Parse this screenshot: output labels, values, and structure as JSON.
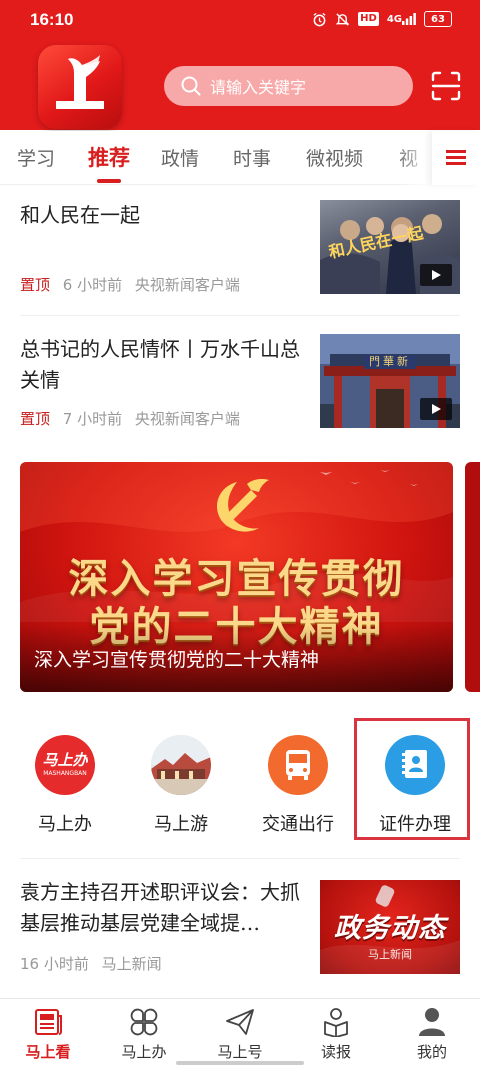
{
  "status_bar": {
    "time": "16:10",
    "hd": "HD",
    "signal": "4G",
    "battery": "63"
  },
  "header": {
    "app_name": "马上看",
    "search_placeholder": "请输入关键字"
  },
  "tabs": [
    {
      "label": "学习",
      "active": false
    },
    {
      "label": "推荐",
      "active": true
    },
    {
      "label": "政情",
      "active": false
    },
    {
      "label": "时事",
      "active": false
    },
    {
      "label": "微视频",
      "active": false
    },
    {
      "label": "视",
      "active": false
    }
  ],
  "news": [
    {
      "title": "和人民在一起",
      "pinned": "置顶",
      "time": "6 小时前",
      "source": "央视新闻客户端",
      "thumb_text": "和人民在一起",
      "has_video": true
    },
    {
      "title": "总书记的人民情怀丨万水千山总关情",
      "pinned": "置顶",
      "time": "7 小时前",
      "source": "央视新闻客户端",
      "thumb_text": "門華新",
      "has_video": true
    }
  ],
  "banner": {
    "line1": "深入学习宣传贯彻",
    "line2": "党的二十大精神",
    "caption": "深入学习宣传贯彻党的二十大精神"
  },
  "services": [
    {
      "label": "马上办",
      "icon": "mashangban-logo-icon",
      "logo_text": "马上办",
      "logo_sub": "MASHANGBAN"
    },
    {
      "label": "马上游",
      "icon": "scenic-photo-icon"
    },
    {
      "label": "交通出行",
      "icon": "bus-icon"
    },
    {
      "label": "证件办理",
      "icon": "id-card-book-icon"
    }
  ],
  "news_bottom": {
    "title": "袁方主持召开述职评议会：大抓基层推动基层党建全域提…",
    "time": "16 小时前",
    "source": "马上新闻",
    "thumb_text": "政务动态",
    "thumb_sub": "马上新闻"
  },
  "bottom_nav": [
    {
      "label": "马上看",
      "icon": "newspaper-icon",
      "active": true
    },
    {
      "label": "马上办",
      "icon": "grid-petals-icon",
      "active": false
    },
    {
      "label": "马上号",
      "icon": "paper-plane-icon",
      "active": false
    },
    {
      "label": "读报",
      "icon": "reading-person-icon",
      "active": false
    },
    {
      "label": "我的",
      "icon": "person-icon",
      "active": false
    }
  ],
  "colors": {
    "brand_red": "#e21b1b",
    "active_red": "#d81e1e",
    "highlight_box": "#d9343f"
  }
}
